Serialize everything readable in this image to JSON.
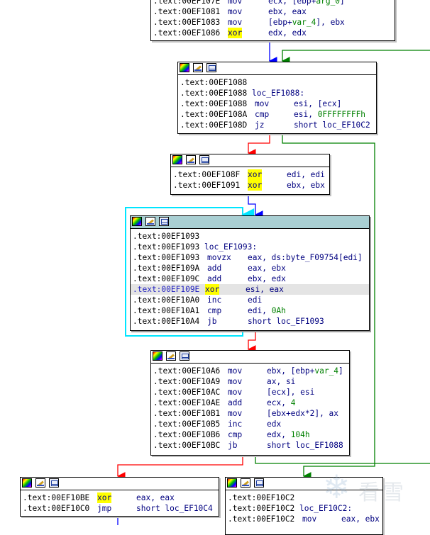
{
  "colors": {
    "edge_true": "#008000",
    "edge_false": "#ff0000",
    "edge_uncond": "#0000ff",
    "edge_loop": "#00e5ff",
    "xor_highlight": "#ffff00",
    "selected_header": "#a9cfd3"
  },
  "header_icons": [
    "color-palette-icon",
    "pencil-icon",
    "graph-icon"
  ],
  "blocks": {
    "b0": {
      "lines": [
        {
          "addr": ".text:00EF107E",
          "mnem": "mov",
          "ops": "ecx, [ebp+arg_0]"
        },
        {
          "addr": ".text:00EF1081",
          "mnem": "mov",
          "ops": "ebx, eax"
        },
        {
          "addr": ".text:00EF1083",
          "mnem": "mov",
          "ops": "[ebp+var_4], ebx"
        },
        {
          "addr": ".text:00EF1086",
          "mnem": "xor",
          "ops": "edx, edx"
        }
      ]
    },
    "b1": {
      "lines": [
        {
          "addr": ".text:00EF1088",
          "mnem": "",
          "ops": ""
        },
        {
          "addr": ".text:00EF1088",
          "label": "loc_EF1088:"
        },
        {
          "addr": ".text:00EF1088",
          "mnem": "mov",
          "ops": "esi, [ecx]"
        },
        {
          "addr": ".text:00EF108A",
          "mnem": "cmp",
          "ops": "esi, 0FFFFFFFFh"
        },
        {
          "addr": ".text:00EF108D",
          "mnem": "jz",
          "ops": "short loc_EF10C2"
        }
      ]
    },
    "b2": {
      "lines": [
        {
          "addr": ".text:00EF108F",
          "mnem": "xor",
          "ops": "edi, edi"
        },
        {
          "addr": ".text:00EF1091",
          "mnem": "xor",
          "ops": "ebx, ebx"
        }
      ]
    },
    "b3": {
      "lines": [
        {
          "addr": ".text:00EF1093",
          "mnem": "",
          "ops": ""
        },
        {
          "addr": ".text:00EF1093",
          "label": "loc_EF1093:"
        },
        {
          "addr": ".text:00EF1093",
          "mnem": "movzx",
          "ops": "eax, ds:byte_F09754[edi]"
        },
        {
          "addr": ".text:00EF109A",
          "mnem": "add",
          "ops": "eax, ebx"
        },
        {
          "addr": ".text:00EF109C",
          "mnem": "add",
          "ops": "ebx, edx"
        },
        {
          "addr": ".text:00EF109E",
          "mnem": "xor",
          "ops": "esi, eax"
        },
        {
          "addr": ".text:00EF10A0",
          "mnem": "inc",
          "ops": "edi"
        },
        {
          "addr": ".text:00EF10A1",
          "mnem": "cmp",
          "ops": "edi, 0Ah"
        },
        {
          "addr": ".text:00EF10A4",
          "mnem": "jb",
          "ops": "short loc_EF1093"
        }
      ]
    },
    "b4": {
      "lines": [
        {
          "addr": ".text:00EF10A6",
          "mnem": "mov",
          "ops": "ebx, [ebp+var_4]"
        },
        {
          "addr": ".text:00EF10A9",
          "mnem": "mov",
          "ops": "ax, si"
        },
        {
          "addr": ".text:00EF10AC",
          "mnem": "mov",
          "ops": "[ecx], esi"
        },
        {
          "addr": ".text:00EF10AE",
          "mnem": "add",
          "ops": "ecx, 4"
        },
        {
          "addr": ".text:00EF10B1",
          "mnem": "mov",
          "ops": "[ebx+edx*2], ax"
        },
        {
          "addr": ".text:00EF10B5",
          "mnem": "inc",
          "ops": "edx"
        },
        {
          "addr": ".text:00EF10B6",
          "mnem": "cmp",
          "ops": "edx, 104h"
        },
        {
          "addr": ".text:00EF10BC",
          "mnem": "jb",
          "ops": "short loc_EF1088"
        }
      ]
    },
    "b5": {
      "lines": [
        {
          "addr": ".text:00EF10BE",
          "mnem": "xor",
          "ops": "eax, eax"
        },
        {
          "addr": ".text:00EF10C0",
          "mnem": "jmp",
          "ops": "short loc_EF10C4"
        }
      ]
    },
    "b6": {
      "lines": [
        {
          "addr": ".text:00EF10C2",
          "mnem": "",
          "ops": ""
        },
        {
          "addr": ".text:00EF10C2",
          "label": "loc_EF10C2:"
        },
        {
          "addr": ".text:00EF10C2",
          "mnem": "mov",
          "ops": "eax, ebx"
        }
      ]
    }
  },
  "watermark": {
    "glyph": "❄",
    "text": "看雪"
  }
}
